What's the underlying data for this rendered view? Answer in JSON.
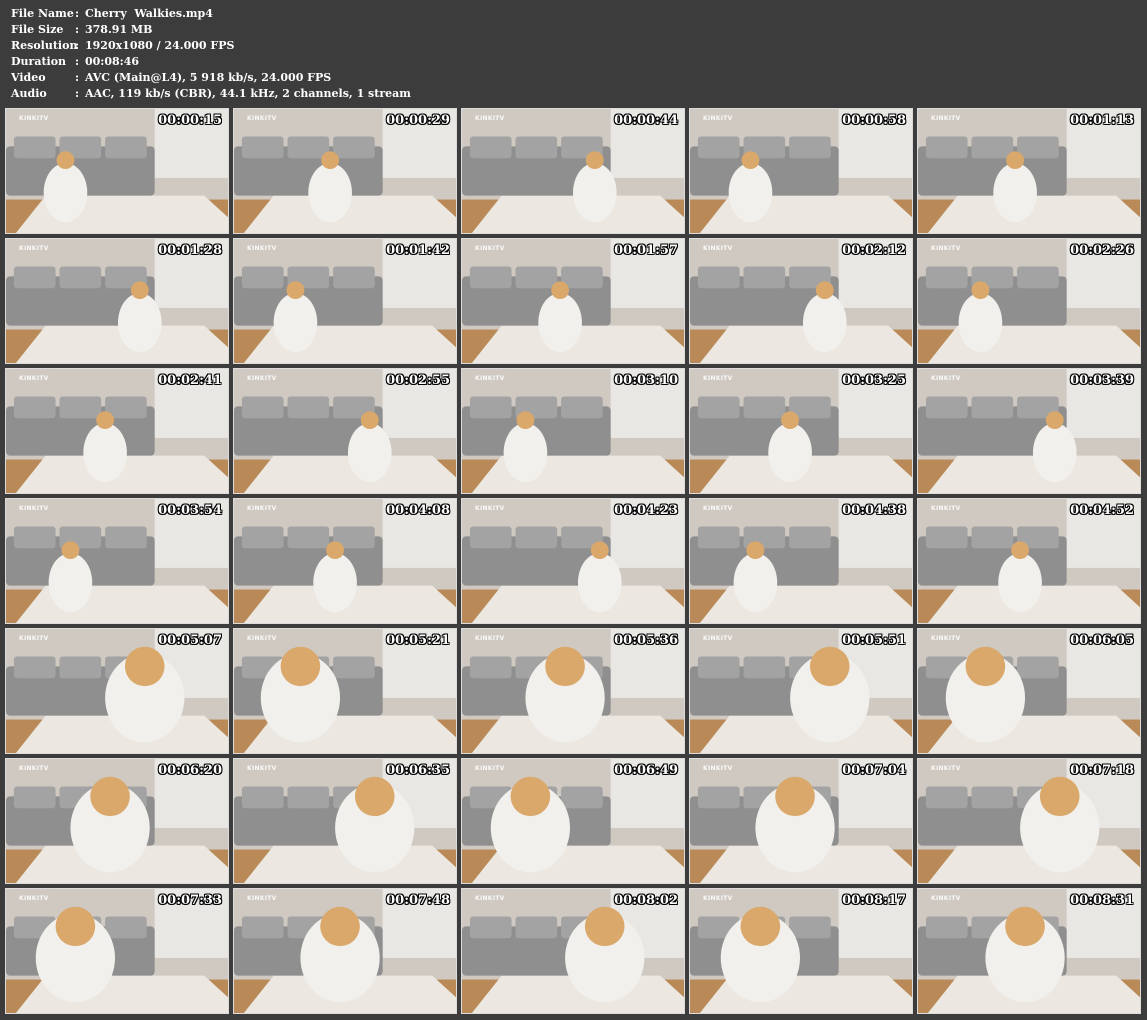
{
  "info": [
    {
      "label": "File Name",
      "sep": ":",
      "value": "Cherry  Walkies.mp4"
    },
    {
      "label": "File Size",
      "sep": ":",
      "value": "378.91 MB"
    },
    {
      "label": "Resolution",
      "sep": ":",
      "value": "1920x1080 / 24.000 FPS"
    },
    {
      "label": "Duration",
      "sep": ":",
      "value": "00:08:46"
    },
    {
      "label": "Video",
      "sep": ":",
      "value": "AVC (Main@L4), 5 918 kb/s, 24.000 FPS"
    },
    {
      "label": "Audio",
      "sep": ":",
      "value": "AAC, 119 kb/s (CBR), 44.1 kHz, 2 channels, 1 stream"
    }
  ],
  "watermark": "KINKITV",
  "thumbnails": [
    {
      "time": "00:00:15"
    },
    {
      "time": "00:00:29"
    },
    {
      "time": "00:00:44"
    },
    {
      "time": "00:00:58"
    },
    {
      "time": "00:01:13"
    },
    {
      "time": "00:01:28"
    },
    {
      "time": "00:01:42"
    },
    {
      "time": "00:01:57"
    },
    {
      "time": "00:02:12"
    },
    {
      "time": "00:02:26"
    },
    {
      "time": "00:02:41"
    },
    {
      "time": "00:02:55"
    },
    {
      "time": "00:03:10"
    },
    {
      "time": "00:03:25"
    },
    {
      "time": "00:03:39"
    },
    {
      "time": "00:03:54"
    },
    {
      "time": "00:04:08"
    },
    {
      "time": "00:04:23"
    },
    {
      "time": "00:04:38"
    },
    {
      "time": "00:04:52"
    },
    {
      "time": "00:05:07"
    },
    {
      "time": "00:05:21"
    },
    {
      "time": "00:05:36"
    },
    {
      "time": "00:05:51"
    },
    {
      "time": "00:06:05"
    },
    {
      "time": "00:06:20"
    },
    {
      "time": "00:06:35"
    },
    {
      "time": "00:06:49"
    },
    {
      "time": "00:07:04"
    },
    {
      "time": "00:07:18"
    },
    {
      "time": "00:07:33"
    },
    {
      "time": "00:07:48"
    },
    {
      "time": "00:08:02"
    },
    {
      "time": "00:08:17"
    },
    {
      "time": "00:08:31"
    }
  ],
  "colors": {
    "background": "#3c3c3c",
    "text": "#ffffff"
  }
}
